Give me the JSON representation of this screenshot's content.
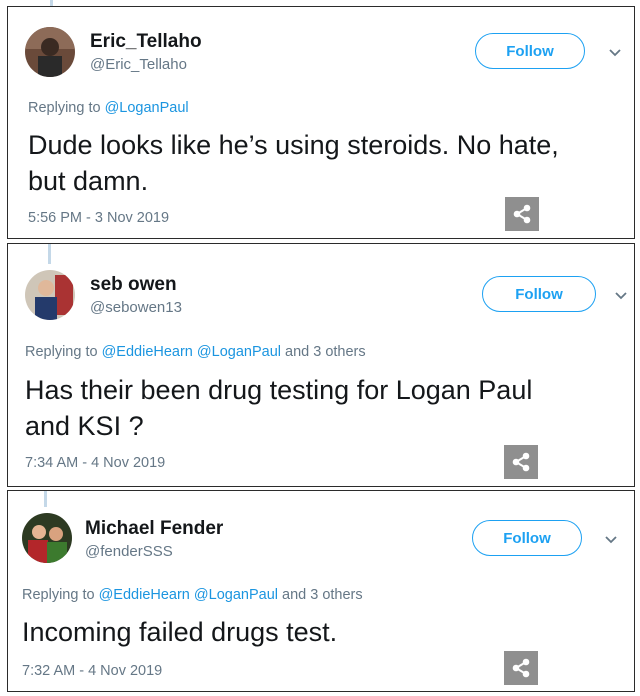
{
  "tweets": [
    {
      "name": "Eric_Tellaho",
      "handle": "@Eric_Tellaho",
      "follow_label": "Follow",
      "reply_prefix": "Replying to ",
      "mention1": "@LoganPaul",
      "mention2": "",
      "reply_suffix": "",
      "text_line1": "Dude looks like he’s using steroids. No hate,",
      "text_line2": "but damn.",
      "timestamp": "5:56 PM - 3 Nov 2019"
    },
    {
      "name": "seb owen",
      "handle": "@sebowen13",
      "follow_label": "Follow",
      "reply_prefix": "Replying to ",
      "mention1": "@EddieHearn",
      "mention2": "@LoganPaul",
      "reply_suffix": " and 3 others",
      "text_line1": "Has their been drug testing  for Logan Paul",
      "text_line2": "and KSI ?",
      "timestamp": "7:34 AM - 4 Nov 2019"
    },
    {
      "name": "Michael Fender",
      "handle": "@fenderSSS",
      "follow_label": "Follow",
      "reply_prefix": "Replying to ",
      "mention1": "@EddieHearn",
      "mention2": "@LoganPaul",
      "reply_suffix": " and 3 others",
      "text_line1": "Incoming failed drugs test.",
      "text_line2": "",
      "timestamp": "7:32 AM - 4 Nov 2019"
    }
  ],
  "colors": {
    "accent": "#1da1f2",
    "mention": "#1b95e0",
    "muted": "#657786",
    "share_bg": "#8f8f8f"
  },
  "icons": {
    "share": "share-icon",
    "chevron": "chevron-down-icon"
  }
}
